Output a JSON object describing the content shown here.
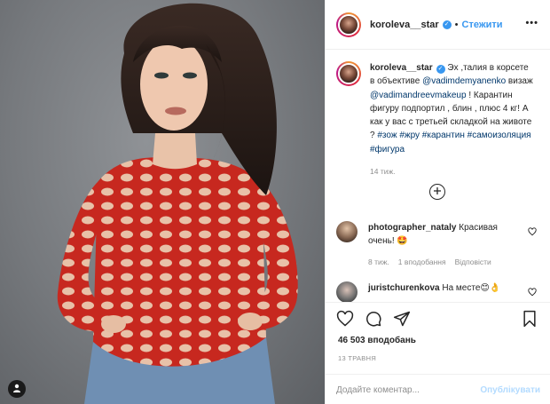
{
  "post": {
    "author": "koroleva__star",
    "follow_label": "Стежити",
    "dot": "•",
    "more_label": "•••",
    "caption": {
      "username": "koroleva__star",
      "p1": " Эх ,талия в корсете в объективе ",
      "mention1": "@vadimdemyanenko",
      "p2": " визаж ",
      "mention2": "@vadimandreevmakeup",
      "p3": " ! Карантин фигуру подпортил , блин , плюс 4 кг! А как у вас с третьей складкой на животе ? ",
      "tag1": "#зож",
      "tag2": "#жру",
      "tag3": "#карантин",
      "tag4": "#самоизоляция",
      "tag5": "#фигура",
      "time": "14 тиж."
    },
    "comments": [
      {
        "username": "photographer_nataly",
        "text": " Красивая очень! 🤩",
        "time": "8 тиж.",
        "likes": "1 вподобання",
        "reply": "Відповісти"
      },
      {
        "username": "juristchurenkova",
        "text": " На месте😊👌"
      }
    ],
    "likes_count": "46 503 вподобань",
    "date": "13 ТРАВНЯ",
    "composer": {
      "placeholder": "Додайте коментар...",
      "post_label": "Опублікувати"
    }
  },
  "icons": {
    "verified": "verified-badge-icon",
    "like": "heart-icon",
    "comment": "comment-bubble-icon",
    "share": "paper-plane-icon",
    "save": "bookmark-icon",
    "add_comments": "plus-circle-icon",
    "tag_users": "user-tag-icon"
  },
  "colors": {
    "accent": "#3897f0",
    "muted": "#8e8e8e",
    "link": "#00376b",
    "text": "#262626"
  }
}
